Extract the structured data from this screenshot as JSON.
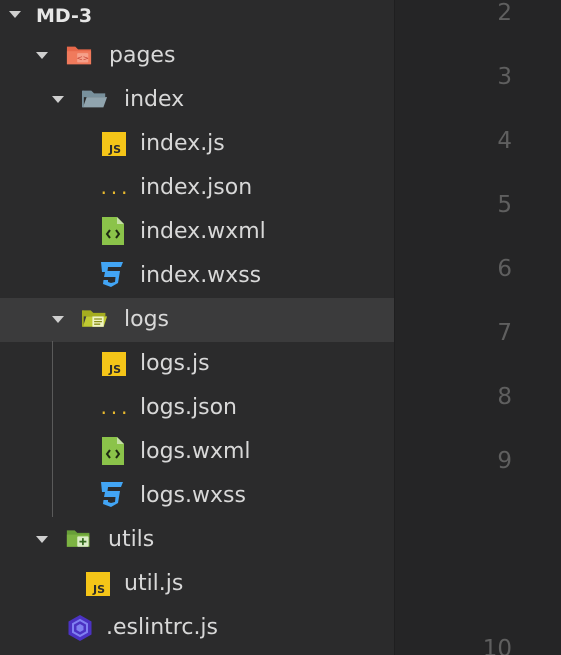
{
  "explorer": {
    "root_label": "MD-3",
    "folders": {
      "pages": "pages",
      "index": "index",
      "logs": "logs",
      "utils": "utils"
    },
    "files": {
      "index_js": "index.js",
      "index_json": "index.json",
      "index_wxml": "index.wxml",
      "index_wxss": "index.wxss",
      "logs_js": "logs.js",
      "logs_json": "logs.json",
      "logs_wxml": "logs.wxml",
      "logs_wxss": "logs.wxss",
      "util_js": "util.js",
      "eslintrc_js": ".eslintrc.js"
    },
    "icon_labels": {
      "js": "JS",
      "json": "{...}"
    },
    "selected": "logs"
  },
  "editor": {
    "line_numbers": [
      "2",
      "3",
      "4",
      "5",
      "6",
      "7",
      "8",
      "9",
      "10"
    ]
  },
  "colors": {
    "sidebar_bg": "#2b2b2c",
    "editor_bg": "#252526",
    "selected_row": "#3b3b3c",
    "js_yellow": "#f5c518",
    "json_yellow": "#e8b92e",
    "wxml_green": "#8bc34a",
    "wxss_blue": "#42a5f5",
    "eslint_purple": "#4b32c3",
    "pages_folder": "#f07a5c",
    "index_folder": "#90a4ae",
    "logs_folder": "#c0ca33",
    "utils_folder": "#7cb342"
  }
}
